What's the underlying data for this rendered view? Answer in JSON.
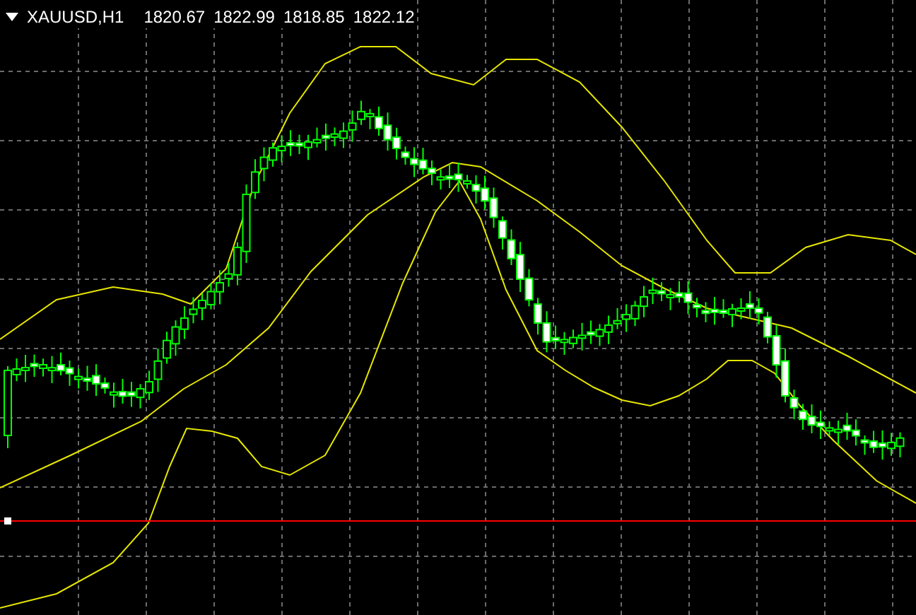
{
  "header": {
    "symbol": "XAUUSD,H1",
    "prices": [
      "1820.67",
      "1822.99",
      "1818.85",
      "1822.12"
    ]
  }
}
